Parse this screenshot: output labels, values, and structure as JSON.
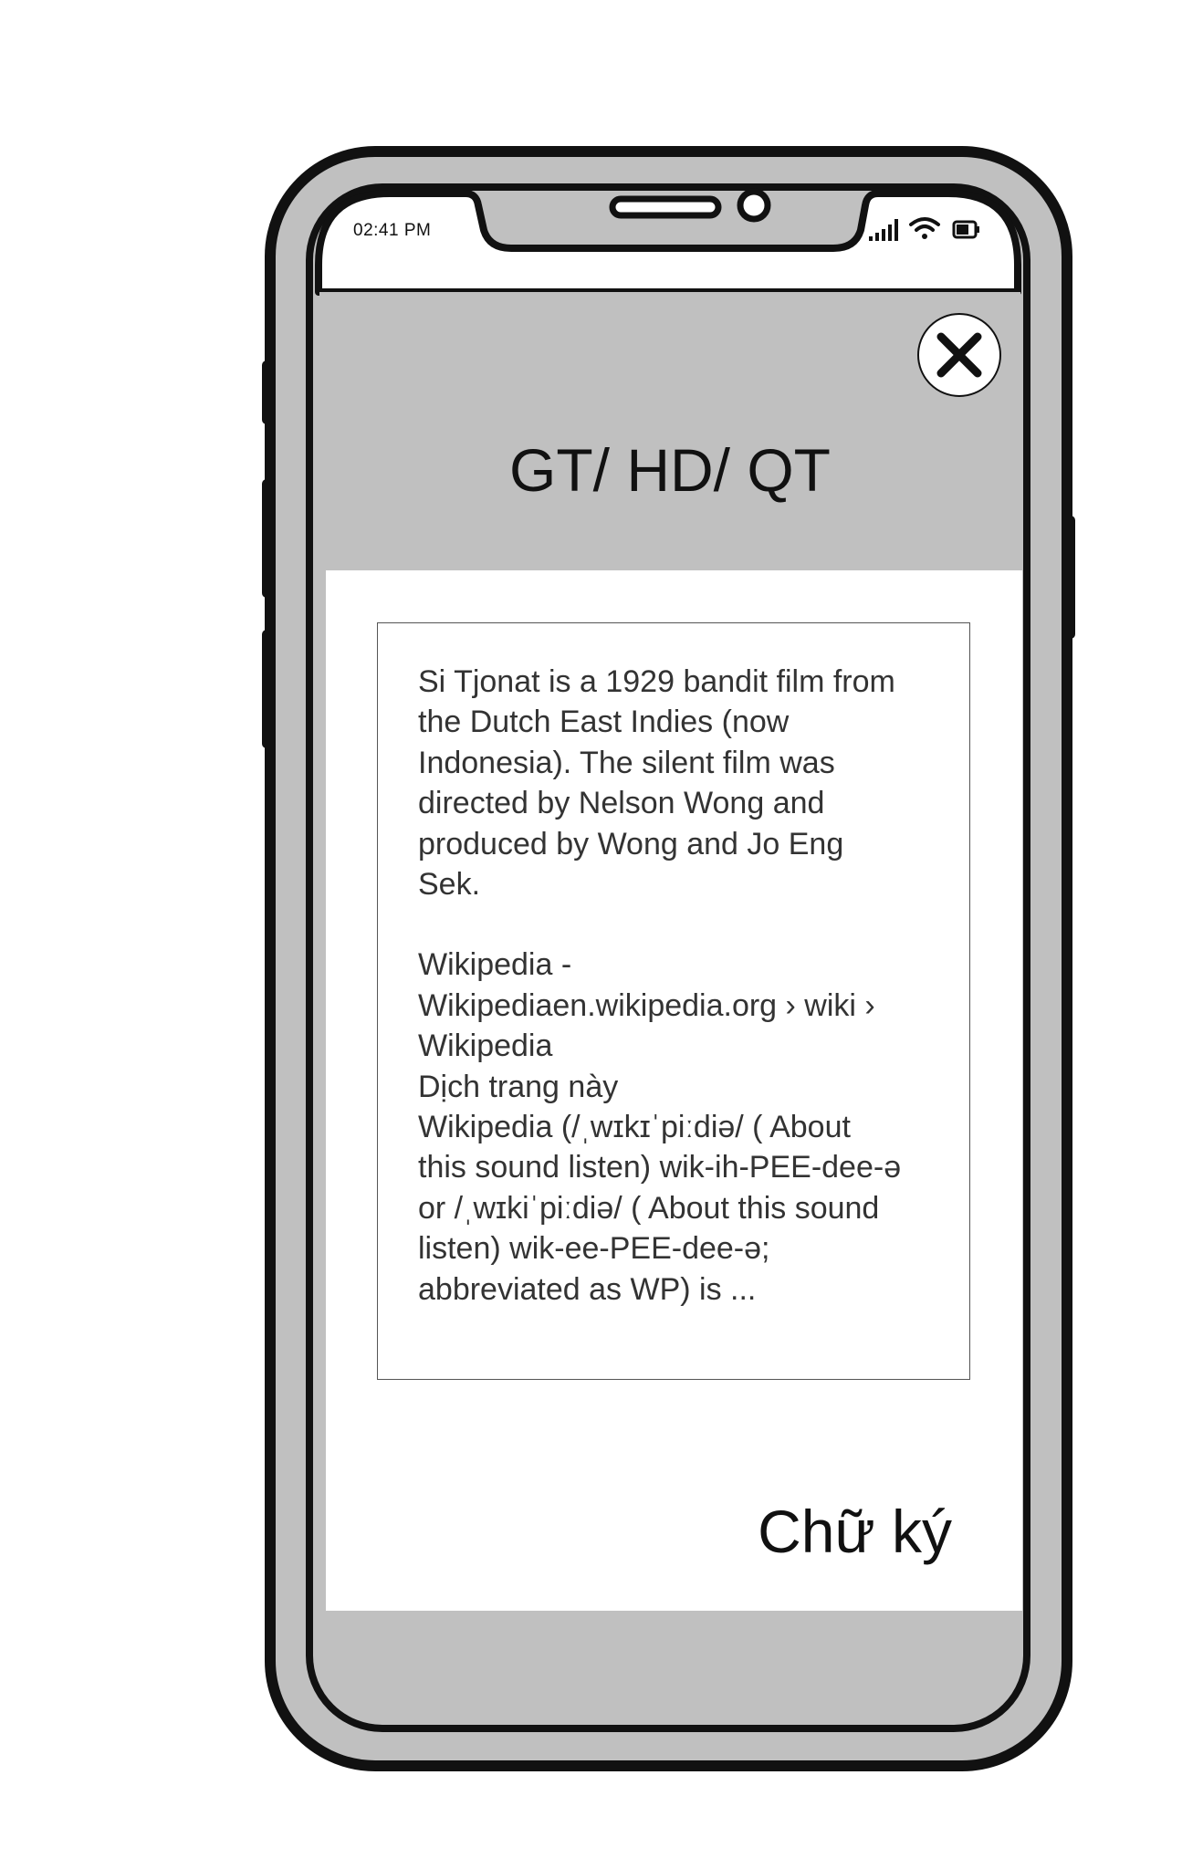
{
  "status_bar": {
    "time": "02:41 PM",
    "icons": [
      "signal-icon",
      "wifi-icon",
      "battery-icon"
    ]
  },
  "header": {
    "title": "GT/ HD/ QT",
    "close_icon": "close-icon",
    "background": "#c0c0c0"
  },
  "content": {
    "paragraph1": "Si Tjonat is a 1929 bandit film from\nthe Dutch East Indies (now\nIndonesia). The silent film was\ndirected by Nelson Wong and\nproduced by Wong and Jo Eng\nSek.",
    "paragraph2": "Wikipedia -\nWikipediaen.wikipedia.org › wiki ›\nWikipedia\nDịch trang này\nWikipedia (/ˌwɪkɪˈpiːdiə/ ( About\nthis sound listen) wik-ih-PEE-dee-ə\nor /ˌwɪkiˈpiːdiə/ ( About this sound\nlisten) wik-ee-PEE-dee-ə;\nabbreviated as WP) is ..."
  },
  "footer": {
    "signature": "Chữ ký"
  }
}
